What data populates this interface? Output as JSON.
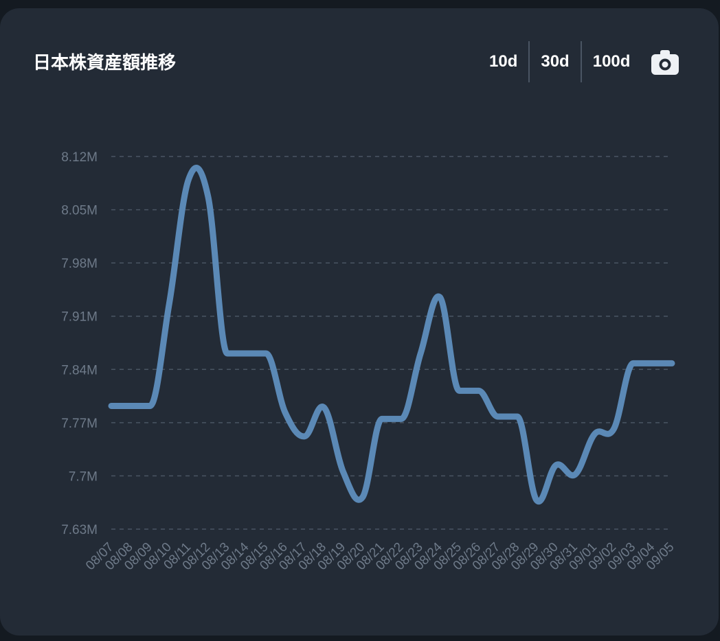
{
  "header": {
    "title": "日本株資産額推移",
    "ranges": [
      "10d",
      "30d",
      "100d"
    ],
    "camera_icon": "camera-icon"
  },
  "colors": {
    "background": "#232b36",
    "line": "#5b89b6",
    "grid": "#4a5563",
    "tick_text": "#6e7a89"
  },
  "chart_data": {
    "type": "line",
    "title": "日本株資産額推移",
    "xlabel": "",
    "ylabel": "",
    "ylim": [
      7.63,
      8.12
    ],
    "y_unit": "M",
    "yticks": [
      7.63,
      7.7,
      7.77,
      7.84,
      7.91,
      7.98,
      8.05,
      8.12
    ],
    "ytick_labels": [
      "7.63M",
      "7.7M",
      "7.77M",
      "7.84M",
      "7.91M",
      "7.98M",
      "8.05M",
      "8.12M"
    ],
    "grid": true,
    "x": [
      "08/07",
      "08/08",
      "08/09",
      "08/10",
      "08/11",
      "08/12",
      "08/13",
      "08/14",
      "08/15",
      "08/16",
      "08/17",
      "08/18",
      "08/19",
      "08/20",
      "08/21",
      "08/22",
      "08/23",
      "08/24",
      "08/25",
      "08/26",
      "08/27",
      "08/28",
      "08/29",
      "08/30",
      "08/31",
      "09/01",
      "09/02",
      "09/03",
      "09/04",
      "09/05"
    ],
    "series": [
      {
        "values": [
          7.792,
          7.792,
          7.792,
          7.927,
          8.09,
          8.068,
          7.861,
          7.861,
          7.861,
          7.783,
          7.752,
          7.79,
          7.705,
          7.672,
          7.775,
          7.775,
          7.861,
          7.935,
          7.812,
          7.812,
          7.778,
          7.778,
          7.668,
          7.714,
          7.702,
          7.755,
          7.762,
          7.848,
          7.848,
          7.848
        ]
      }
    ]
  }
}
